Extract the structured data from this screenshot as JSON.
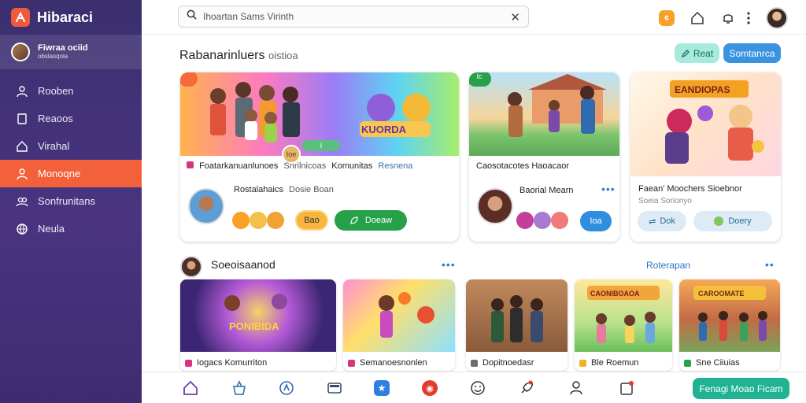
{
  "app": {
    "name": "Hibaraci"
  },
  "profile": {
    "name_line1": "Fiwraa ociid",
    "name_line2": "obslasqoia"
  },
  "sidebar": {
    "items": [
      {
        "label": "Rooben",
        "icon": "person-icon"
      },
      {
        "label": "Reaoos",
        "icon": "document-icon"
      },
      {
        "label": "Virahal",
        "icon": "home-icon"
      },
      {
        "label": "Monoqne",
        "icon": "person-group-icon"
      },
      {
        "label": "Sonfrunitans",
        "icon": "people-icon"
      },
      {
        "label": "Neula",
        "icon": "globe-icon"
      }
    ],
    "active_index": 3
  },
  "search": {
    "value": "Ihoartan Sams Virinth"
  },
  "header": {
    "title": "Rabanarinluers",
    "subtitle": "oistioa"
  },
  "actions": {
    "edit_label": "Reat",
    "blue_label": "Somtanrca"
  },
  "featured": [
    {
      "title_prefix": "Foatarkanuanlunoes",
      "title_main": "Snrilnicoas",
      "title_suffix": "Komunitas",
      "title_tail": "Resnena",
      "sub_title": "Rostalahaics",
      "sub_title2": "Dosie Boan",
      "coin_label": "Ioe",
      "banner_badge": "I",
      "orange_btn": "Bao",
      "green_btn": "Doeaw",
      "logo_text": "KUORDA"
    },
    {
      "title": "Caosotacotes Haoacaor",
      "sub_title": "Baorial Mearn",
      "blue_btn": "Ioa",
      "banner_badge": "Ic"
    },
    {
      "title_logo": "EANDIOPAS",
      "title": "Faean' Moochers Sioebnor",
      "sub_title": "Soeia Sorionyo",
      "light_btn": "Dok",
      "light_btn2": "Doery"
    }
  ],
  "row2": {
    "title": "Soeoisaanod",
    "link": "Roterapan",
    "cards": [
      {
        "label": "Iogacs Komurriton",
        "logo": "PONIBIDA",
        "color": "#d8357e"
      },
      {
        "label": "Semanoesnonlen",
        "color": "#d8357e"
      },
      {
        "label": "Dopitnoedasr",
        "color": "#6b6b6b"
      },
      {
        "label": "Ble Roemun",
        "logo": "CAONIBOAOA",
        "color": "#f0b22c"
      },
      {
        "label": "Sne Ciiuias",
        "logo": "CAROOMATE",
        "color": "#27a04a"
      }
    ]
  },
  "bottom_nav": {
    "icons": [
      "home-icon",
      "basket-icon",
      "compass-icon",
      "tv-icon",
      "blue-star-badge-icon",
      "red-circle-badge-icon",
      "smile-icon",
      "rocket-icon",
      "user-icon",
      "inbox-icon"
    ],
    "cta": "Fenagi Moao Ficam"
  },
  "colors": {
    "sidebar": "#3b2f6e",
    "active": "#f2613a",
    "green": "#27a04a",
    "blue": "#3b93e0",
    "teal": "#1fb392"
  }
}
